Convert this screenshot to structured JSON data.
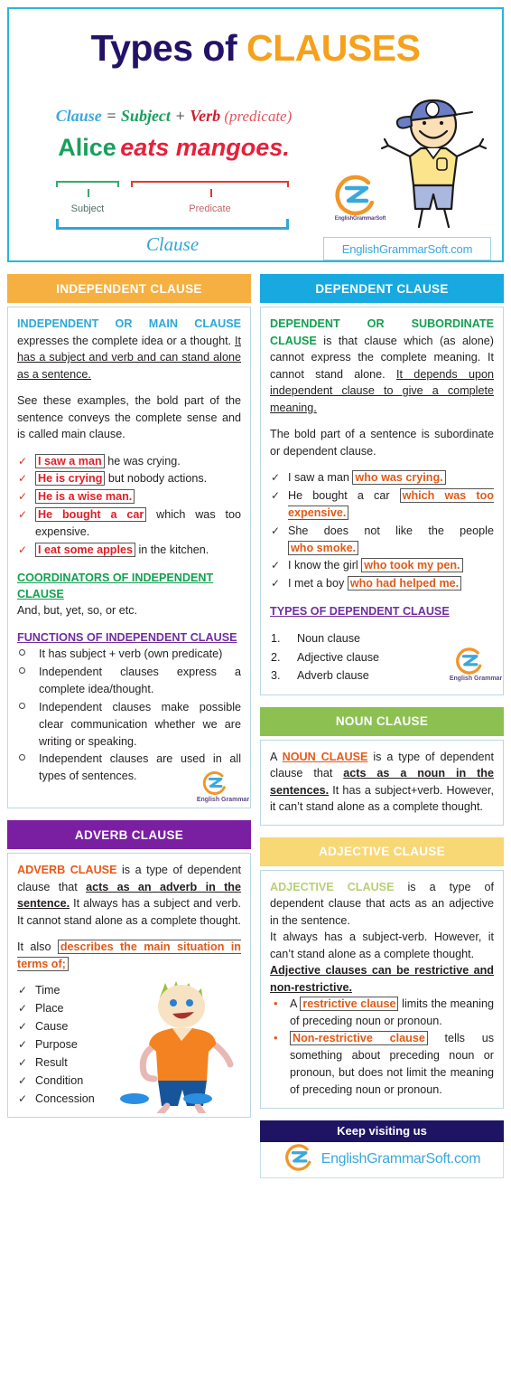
{
  "header": {
    "title_part1": "Types of ",
    "title_part2": "CLAUSES",
    "formula": {
      "clause": "Clause",
      "equals": " = ",
      "subject": "Subject",
      "plus": " + ",
      "verb": "Verb",
      "predicate": " (predicate)"
    },
    "example": {
      "subject": "Alice",
      "predicate": "eats mangoes."
    },
    "label_subject": "Subject",
    "label_predicate": "Predicate",
    "label_clause": "Clause",
    "brand_logo_text": "EnglishGrammarSoft",
    "website": "EnglishGrammarSoft.com"
  },
  "independent": {
    "heading": "INDEPENDENT CLAUSE",
    "heading_color": "#f5b041",
    "intro_highlight": "INDEPENDENT OR MAIN CLAUSE",
    "intro_rest": " expresses the complete idea or a thought. ",
    "intro_underlined": "It has a subject and verb and can stand alone as a sentence.",
    "para2": "See these examples, the bold part of the sentence conveys the complete sense and is called main clause.",
    "examples": [
      {
        "boxed": "I saw a man",
        "rest": " he was crying."
      },
      {
        "boxed": "He is crying",
        "rest": " but nobody actions."
      },
      {
        "boxed": "He is a wise man.",
        "rest": ""
      },
      {
        "boxed": "He bought a car",
        "rest": " which was too expensive."
      },
      {
        "boxed": "I  eat  some  apples",
        "rest": " in the kitchen."
      }
    ],
    "coordinators_heading": "COORDINATORS OF INDEPENDENT CLAUSE",
    "coordinators_text": "And, but, yet, so, or etc.",
    "functions_heading": "FUNCTIONS OF INDEPENDENT CLAUSE",
    "functions": [
      "It has subject + verb (own predicate)",
      "Independent clauses express a complete idea/thought.",
      "Independent clauses make possible clear communication whether we are writing or speaking.",
      "Independent clauses are used in all types of sentences."
    ],
    "mini_logo_text": "English Grammar"
  },
  "dependent": {
    "heading": "DEPENDENT CLAUSE",
    "heading_color": "#17a9e0",
    "intro_highlight": "DEPENDENT OR SUBORDINATE CLAUSE",
    "intro_rest": " is that clause which (as alone) cannot express the complete meaning. It cannot stand alone. ",
    "intro_underlined": "It depends upon independent clause to give a complete meaning.",
    "para2": "The bold part of a sentence is subordinate or dependent clause.",
    "examples": [
      {
        "pre": "I saw a man ",
        "boxed": "who was crying.",
        "post": ""
      },
      {
        "pre": "He bought a car ",
        "boxed": "which was too expensive.",
        "post": ""
      },
      {
        "pre": "She does not like the people ",
        "boxed": "who smoke.",
        "post": ""
      },
      {
        "pre": "I know the girl ",
        "boxed": "who took my pen.",
        "post": ""
      },
      {
        "pre": "I met a boy ",
        "boxed": "who had helped me.",
        "post": ""
      }
    ],
    "types_heading": "TYPES OF DEPENDENT  CLAUSE",
    "types": [
      "Noun clause",
      "Adjective clause",
      "Adverb clause"
    ],
    "mini_logo_text": "English Grammar"
  },
  "noun_clause": {
    "heading": "NOUN CLAUSE",
    "heading_color": "#8cc152",
    "p_a": "A ",
    "p_highlight": "NOUN CLAUSE",
    "p_b": " is a type of dependent clause that ",
    "p_bold": "acts as a noun in the sentences.",
    "p_c": " It has a subject+verb. However, it can’t stand alone as a complete thought."
  },
  "adjective_clause": {
    "heading": "ADJECTIVE CLAUSE",
    "heading_color": "#f8d775",
    "p_highlight": "ADJECTIVE CLAUSE",
    "p_a": " is a type of dependent clause that acts as an adjective in the sentence.",
    "p_b": "It always has a subject-verb. However, it can’t stand alone as a complete thought.",
    "p_bold": "Adjective clauses can be restrictive and non-restrictive.",
    "bullets": [
      {
        "pre": "A ",
        "boxed": "restrictive  clause",
        "post": " limits the meaning of preceding noun or pronoun."
      },
      {
        "pre": "",
        "boxed": "Non-restrictive  clause",
        "post": " tells us something about preceding noun or pronoun, but does not limit the meaning of preceding noun or pronoun."
      }
    ]
  },
  "adverb_clause": {
    "heading": "ADVERB CLAUSE",
    "heading_color": "#7b1fa2",
    "p_highlight": "ADVERB CLAUSE",
    "p_a": " is a type of dependent clause that ",
    "p_bold": "acts as an adverb in the sentence.",
    "p_b": " It always has a subject and verb. It cannot stand alone as a complete thought.",
    "p_c": "It also ",
    "p_boxed": "describes the main situation in terms of;",
    "list": [
      "Time",
      "Place",
      "Cause",
      "Purpose",
      "Result",
      "Condition",
      "Concession"
    ]
  },
  "footer": {
    "band_text": "Keep visiting us",
    "url": "EnglishGrammarSoft.com",
    "logo_text": "EnglishGrammarSoft"
  }
}
